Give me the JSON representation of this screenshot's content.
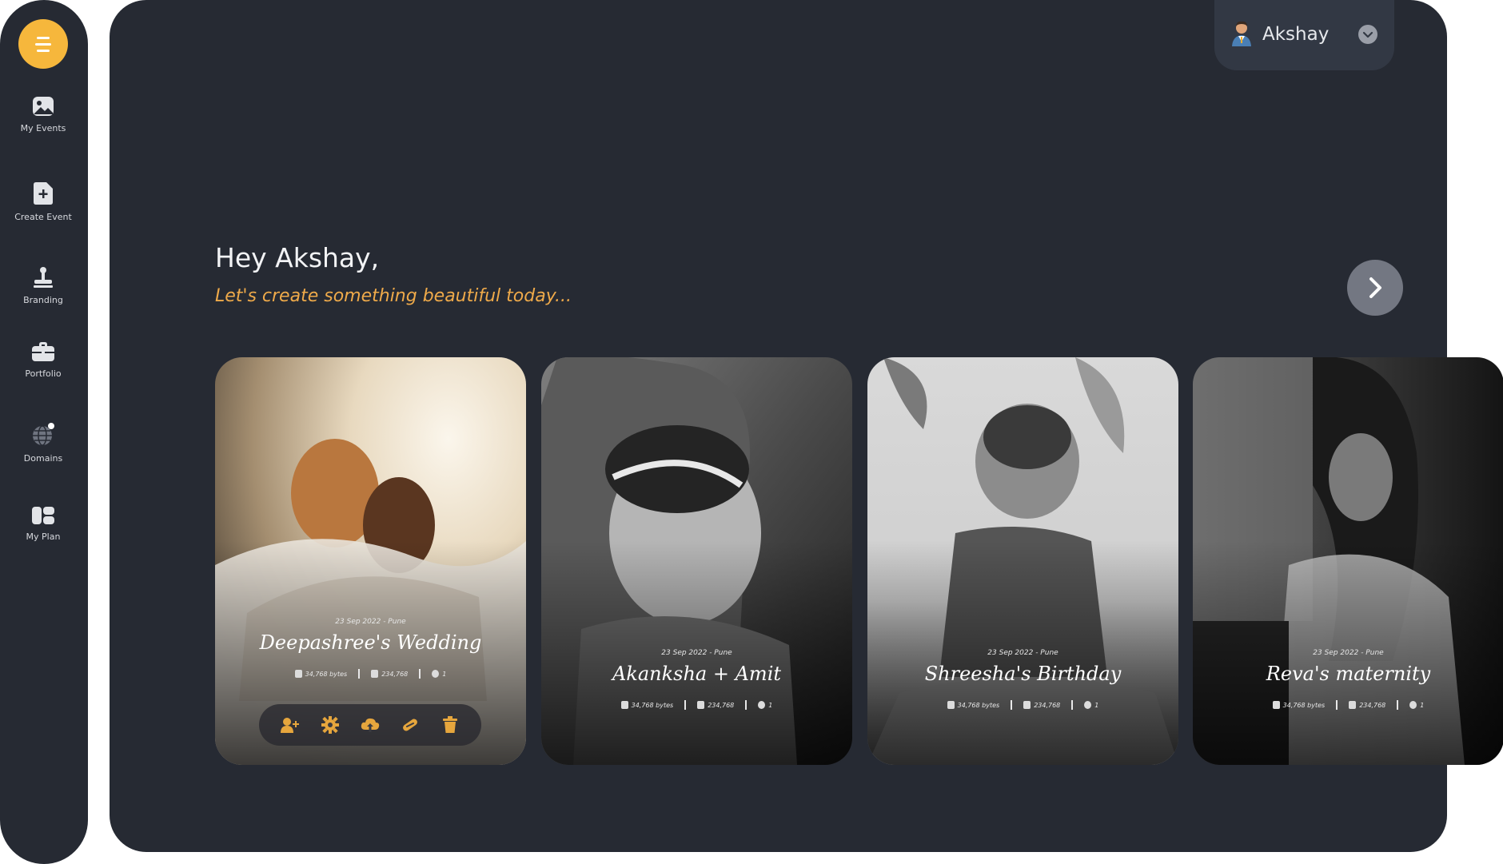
{
  "sidebar": {
    "items": [
      {
        "label": "My Events",
        "icon": "image-icon"
      },
      {
        "label": "Create Event",
        "icon": "add-file-icon"
      },
      {
        "label": "Branding",
        "icon": "stamp-icon"
      },
      {
        "label": "Portfolio",
        "icon": "briefcase-icon"
      },
      {
        "label": "Domains",
        "icon": "globe-icon"
      },
      {
        "label": "My Plan",
        "icon": "plan-icon"
      }
    ]
  },
  "user": {
    "name": "Akshay"
  },
  "greeting": {
    "title": "Hey Akshay,",
    "subtitle": "Let's create something beautiful today..."
  },
  "events": [
    {
      "date": "23 Sep 2022 - Pune",
      "title": "Deepashree's Wedding",
      "size": "34,768 bytes",
      "photos": "234,768",
      "guests": "1"
    },
    {
      "date": "23 Sep 2022 - Pune",
      "title": "Akanksha + Amit",
      "size": "34,768 bytes",
      "photos": "234,768",
      "guests": "1"
    },
    {
      "date": "23 Sep 2022 - Pune",
      "title": "Shreesha's Birthday",
      "size": "34,768 bytes",
      "photos": "234,768",
      "guests": "1"
    },
    {
      "date": "23 Sep 2022 - Pune",
      "title": "Reva's maternity",
      "size": "34,768 bytes",
      "photos": "234,768",
      "guests": "1"
    }
  ],
  "colors": {
    "accent": "#f6b73c",
    "subtitle": "#efaa4a",
    "panel": "#262a33"
  }
}
